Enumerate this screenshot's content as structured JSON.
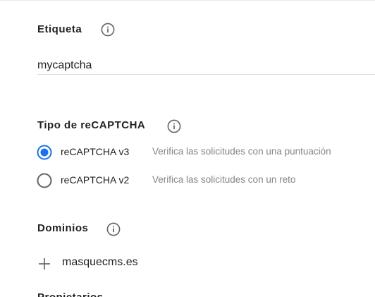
{
  "sections": {
    "label": {
      "title": "Etiqueta",
      "info_icon": "info-icon",
      "input_value": "mycaptcha"
    },
    "type": {
      "title": "Tipo de reCAPTCHA",
      "info_icon": "info-icon",
      "options": [
        {
          "label": "reCAPTCHA v3",
          "description": "Verifica las solicitudes con una puntuación",
          "selected": true
        },
        {
          "label": "reCAPTCHA v2",
          "description": "Verifica las solicitudes con un reto",
          "selected": false
        }
      ]
    },
    "domains": {
      "title": "Dominios",
      "info_icon": "info-icon",
      "add_icon": "plus-icon",
      "items": [
        "masquecms.es"
      ]
    },
    "next": {
      "title": "Propietarios"
    }
  },
  "colors": {
    "accent": "#1a73e8",
    "text": "#202124",
    "secondary_text": "#80868b",
    "icon": "#5f6368",
    "divider": "#dadce0"
  }
}
